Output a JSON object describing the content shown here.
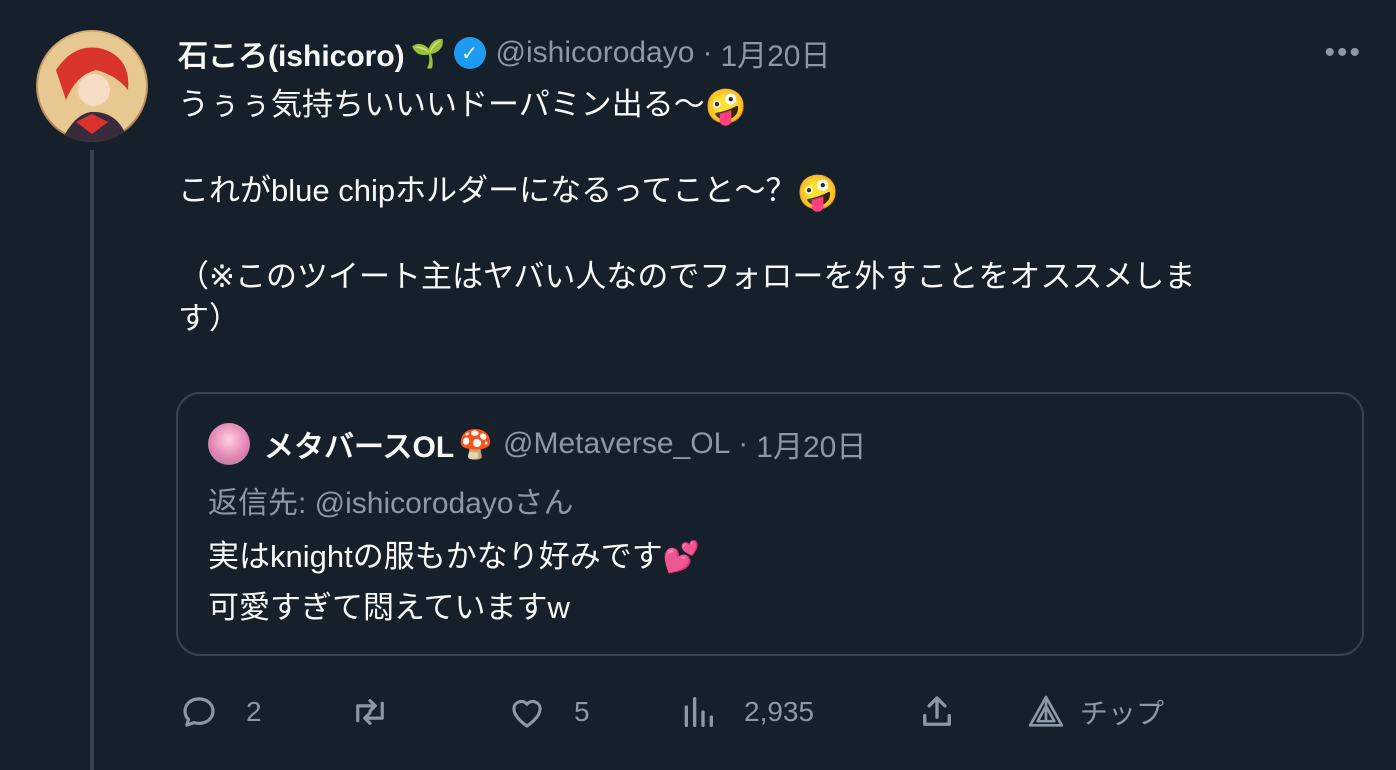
{
  "tweet": {
    "author_name": "石ころ(ishicoro)",
    "author_emoji": "🌱",
    "handle": "@ishicorodayo",
    "separator": "·",
    "date": "1月20日",
    "more": "•••",
    "line1": "うぅぅ気持ちいいいドーパミン出る〜",
    "line1_emoji": "🤪",
    "line2": "これがblue chipホルダーになるってこと〜？",
    "line2_emoji": "🤪",
    "line3": "（※このツイート主はヤバい人なのでフォローを外すことをオススメしま",
    "line4": "す）"
  },
  "quote": {
    "author_name": "メタバースOL",
    "author_emoji": "🍄",
    "handle": "@Metaverse_OL",
    "separator": "·",
    "date": "1月20日",
    "reply_to": "返信先: @ishicorodayoさん",
    "line1": "実はknightの服もかなり好みです",
    "line1_emoji": "💕",
    "line2": "可愛すぎて悶えていますw"
  },
  "actions": {
    "reply_count": "2",
    "retweet_count": "",
    "like_count": "5",
    "view_count": "2,935",
    "tip_label": "チップ"
  },
  "icons": [
    "reply-icon",
    "retweet-icon",
    "like-icon",
    "views-icon",
    "share-icon",
    "tip-icon",
    "verified-icon",
    "more-icon"
  ],
  "colors": {
    "background": "#15202b",
    "text": "#f7f9f9",
    "muted": "#8b98a5",
    "border": "#38444d",
    "verified": "#1d9bf0"
  }
}
